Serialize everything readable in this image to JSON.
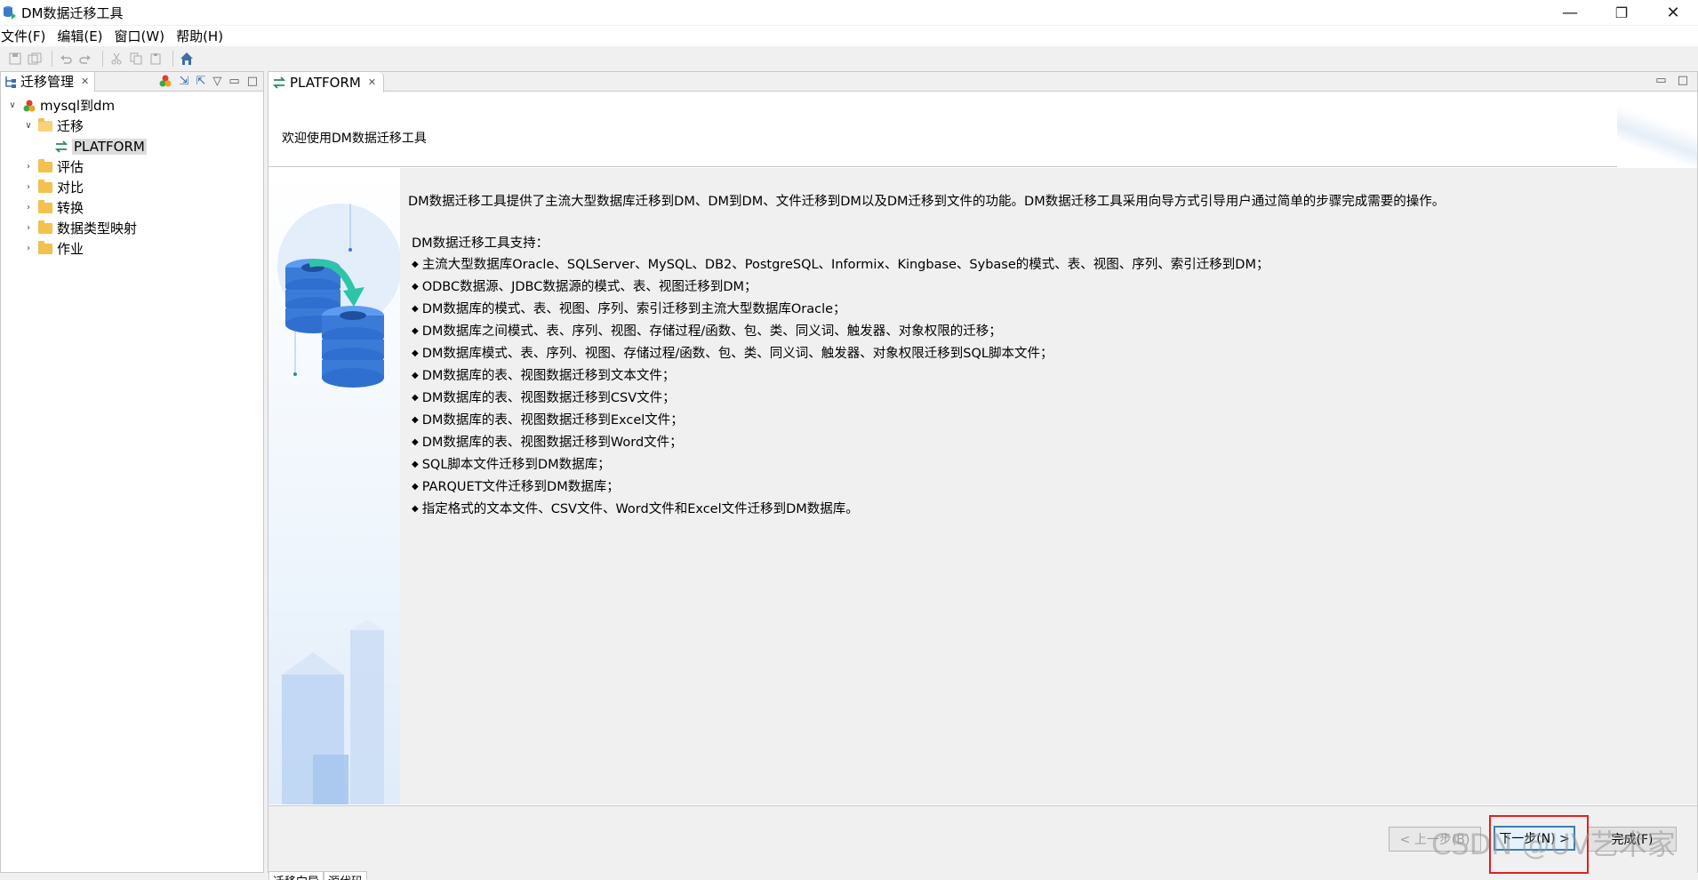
{
  "window": {
    "title": "DM数据迁移工具",
    "minimize": "—",
    "maximize": "❐",
    "close": "✕"
  },
  "menu": [
    "文件(F)",
    "编辑(E)",
    "窗口(W)",
    "帮助(H)"
  ],
  "left_panel": {
    "tab_label": "迁移管理",
    "tree": {
      "root": "mysql到dm",
      "migration_folder": "迁移",
      "platform_item": "PLATFORM",
      "folders": [
        "评估",
        "对比",
        "转换",
        "数据类型映射",
        "作业"
      ]
    }
  },
  "editor": {
    "tab_label": "PLATFORM",
    "header_title": "欢迎使用DM数据迁移工具",
    "intro": "DM数据迁移工具提供了主流大型数据库迁移到DM、DM到DM、文件迁移到DM以及DM迁移到文件的功能。DM数据迁移工具采用向导方式引导用户通过简单的步骤完成需要的操作。",
    "support_heading": "DM数据迁移工具支持：",
    "support_items": [
      "主流大型数据库Oracle、SQLServer、MySQL、DB2、PostgreSQL、Informix、Kingbase、Sybase的模式、表、视图、序列、索引迁移到DM；",
      "ODBC数据源、JDBC数据源的模式、表、视图迁移到DM；",
      "DM数据库的模式、表、视图、序列、索引迁移到主流大型数据库Oracle；",
      "DM数据库之间模式、表、序列、视图、存储过程/函数、包、类、同义词、触发器、对象权限的迁移；",
      "DM数据库模式、表、序列、视图、存储过程/函数、包、类、同义词、触发器、对象权限迁移到SQL脚本文件；",
      "DM数据库的表、视图数据迁移到文本文件；",
      "DM数据库的表、视图数据迁移到CSV文件；",
      "DM数据库的表、视图数据迁移到Excel文件；",
      "DM数据库的表、视图数据迁移到Word文件；",
      "SQL脚本文件迁移到DM数据库；",
      "PARQUET文件迁移到DM数据库；",
      "指定格式的文本文件、CSV文件、Word文件和Excel文件迁移到DM数据库。"
    ],
    "buttons": {
      "back": "< 上一步(B)",
      "next": "下一步(N) >",
      "finish": "完成(F)"
    },
    "bottom_tabs": [
      "迁移向导",
      "源代码"
    ]
  },
  "watermark": "CSDN @UV艺术家",
  "colors": {
    "highlight": "#e02020",
    "accent": "#3a6ea5",
    "folder": "#f2c14e"
  }
}
